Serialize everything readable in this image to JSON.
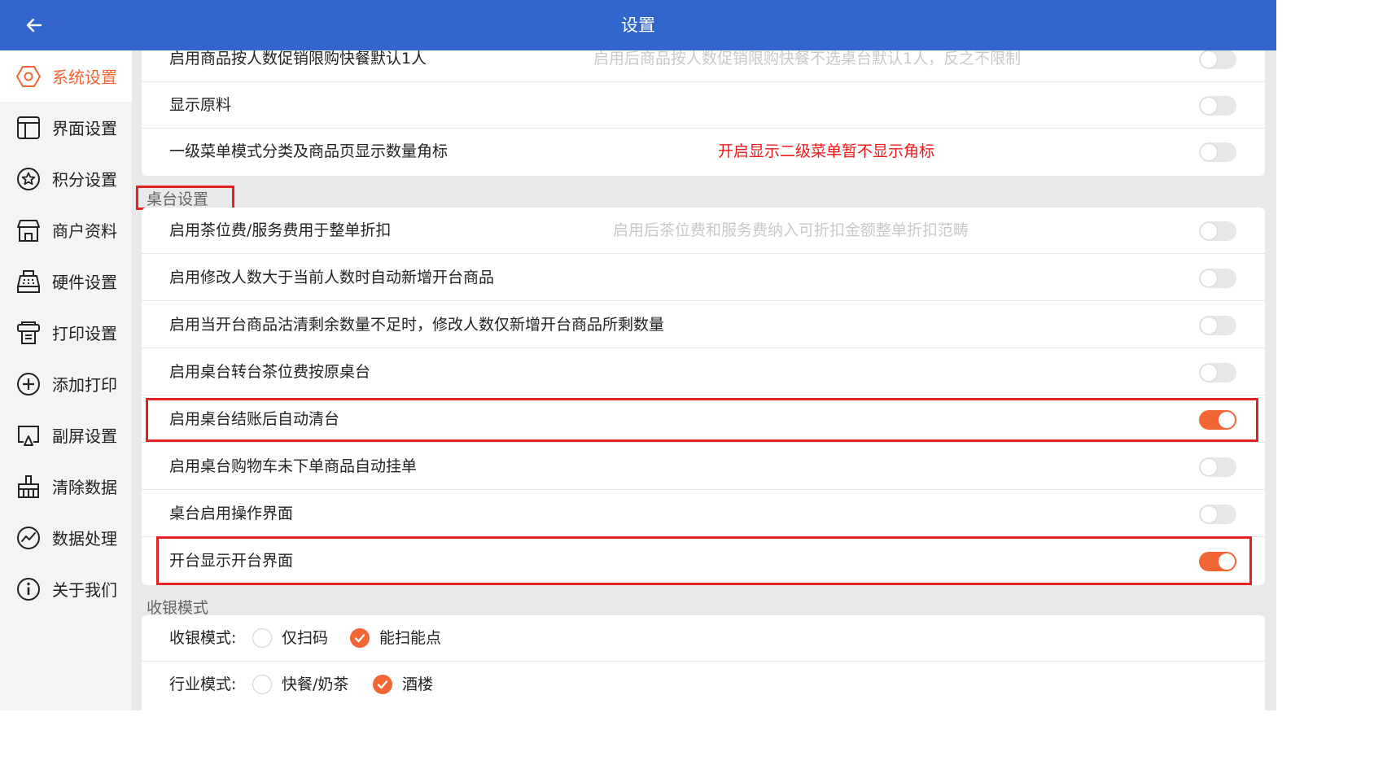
{
  "header": {
    "title": "设置"
  },
  "colors": {
    "header_bg": "#3366cc",
    "accent": "#f26535",
    "warning_red": "#f01818",
    "highlight_box": "#e52222"
  },
  "sidebar": {
    "items": [
      {
        "label": "系统设置",
        "icon": "hexagon-settings-icon",
        "active": true
      },
      {
        "label": "界面设置",
        "icon": "layout-icon"
      },
      {
        "label": "积分设置",
        "icon": "star-circle-icon"
      },
      {
        "label": "商户资料",
        "icon": "store-icon"
      },
      {
        "label": "硬件设置",
        "icon": "cash-register-icon"
      },
      {
        "label": "打印设置",
        "icon": "printer-receipt-icon"
      },
      {
        "label": "添加打印",
        "icon": "plus-circle-icon"
      },
      {
        "label": "副屏设置",
        "icon": "display-icon"
      },
      {
        "label": "清除数据",
        "icon": "broom-icon"
      },
      {
        "label": "数据处理",
        "icon": "chart-circle-icon"
      },
      {
        "label": "关于我们",
        "icon": "info-icon"
      }
    ]
  },
  "top_card": {
    "rows": [
      {
        "label": "启用商品按人数促销限购快餐默认1人",
        "desc": "启用后商品按人数促销限购快餐不选桌台默认1人，反之不限制",
        "on": false
      },
      {
        "label": "显示原料",
        "desc": "",
        "on": false
      },
      {
        "label": "一级菜单模式分类及商品页显示数量角标",
        "desc": "开启显示二级菜单暂不显示角标",
        "on": false
      }
    ]
  },
  "table_section": {
    "title": "桌台设置",
    "rows": [
      {
        "label": "启用茶位费/服务费用于整单折扣",
        "desc": "启用后茶位费和服务费纳入可折扣金额整单折扣范畴",
        "on": false
      },
      {
        "label": "启用修改人数大于当前人数时自动新增开台商品",
        "desc": "",
        "on": false
      },
      {
        "label": "启用当开台商品沽清剩余数量不足时，修改人数仅新增开台商品所剩数量",
        "desc": "",
        "on": false
      },
      {
        "label": "启用桌台转台茶位费按原桌台",
        "desc": "",
        "on": false
      },
      {
        "label": "启用桌台结账后自动清台",
        "desc": "",
        "on": true
      },
      {
        "label": "启用桌台购物车未下单商品自动挂单",
        "desc": "",
        "on": false
      },
      {
        "label": "桌台启用操作界面",
        "desc": "",
        "on": false
      },
      {
        "label": "开台显示开台界面",
        "desc": "",
        "on": true
      }
    ]
  },
  "cashier_section": {
    "title": "收银模式",
    "cashier_mode": {
      "label": "收银模式:",
      "options": [
        "仅扫码",
        "能扫能点"
      ],
      "selected": "能扫能点"
    },
    "industry_mode": {
      "label": "行业模式:",
      "options": [
        "快餐/奶茶",
        "酒楼"
      ],
      "selected": "酒楼"
    }
  }
}
